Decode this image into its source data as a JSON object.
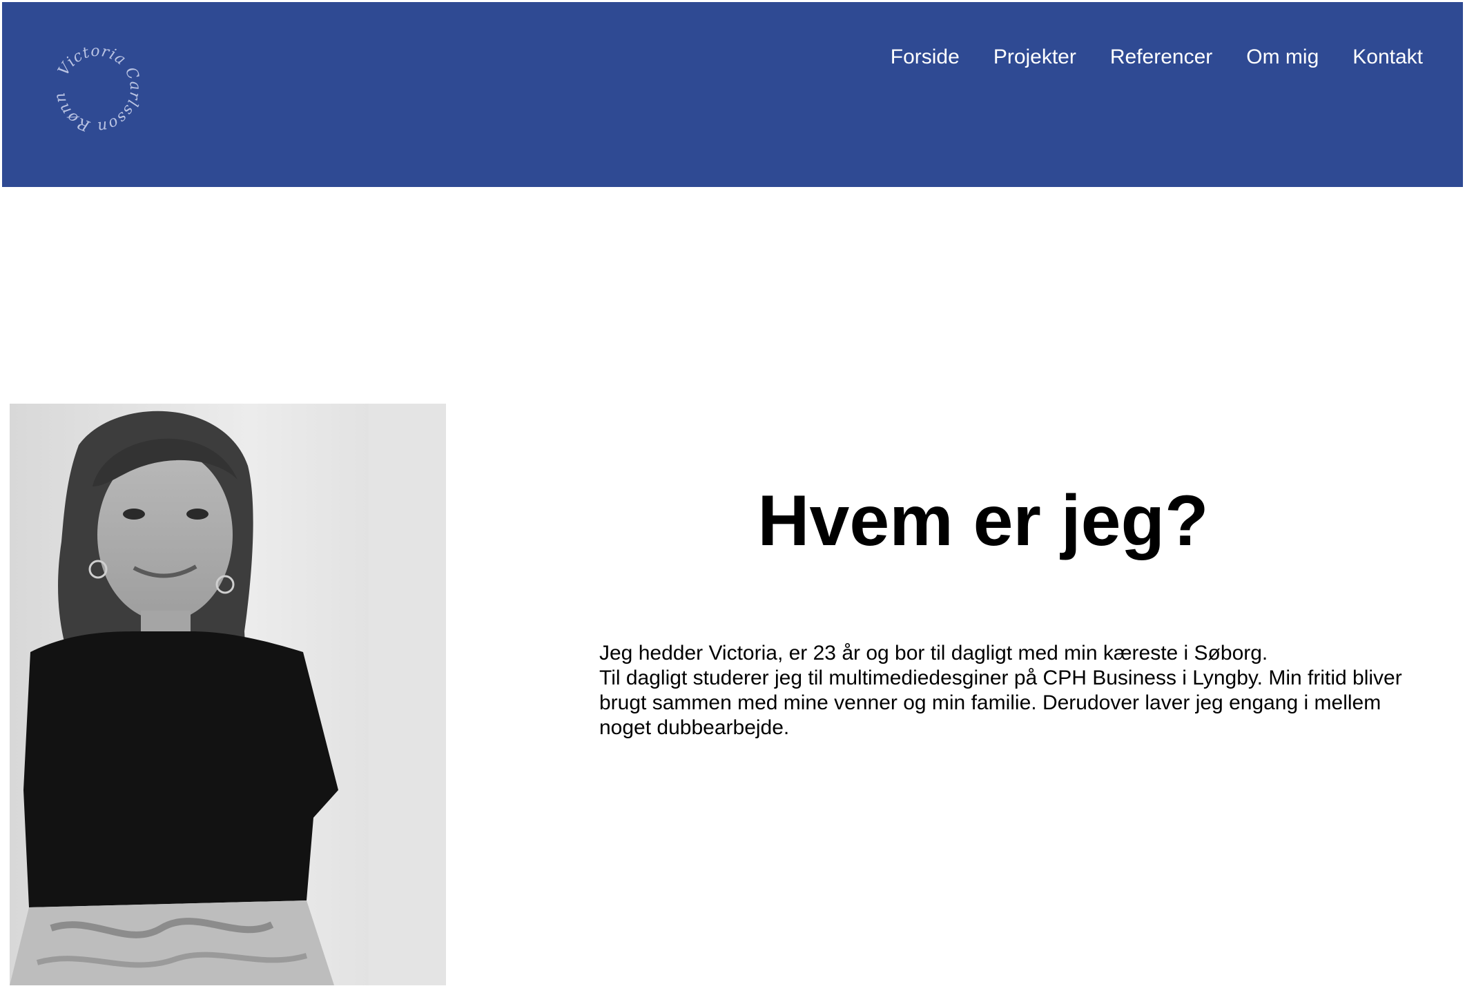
{
  "colors": {
    "header_bg": "#2f4a93",
    "nav_text": "#ffffff",
    "logo_text": "#b9c3e3",
    "body_text": "#000000"
  },
  "logo": {
    "text": "Victoria Carlsson Rønne",
    "icon": "handwritten-circular-logo"
  },
  "nav": {
    "items": [
      {
        "label": "Forside"
      },
      {
        "label": "Projekter"
      },
      {
        "label": "Referencer"
      },
      {
        "label": "Om mig"
      },
      {
        "label": "Kontakt"
      }
    ]
  },
  "main": {
    "photo_icon": "portrait-photo",
    "heading": "Hvem er jeg?",
    "bio_line_1": "Jeg hedder Victoria, er 23 år og bor til dagligt med min kæreste i Søborg.",
    "bio_line_2": "Til dagligt studerer jeg til multimediedesginer på CPH Business i Lyngby. Min fritid bliver brugt sammen med mine venner og min familie. Derudover laver jeg engang i mellem noget dubbearbejde."
  }
}
